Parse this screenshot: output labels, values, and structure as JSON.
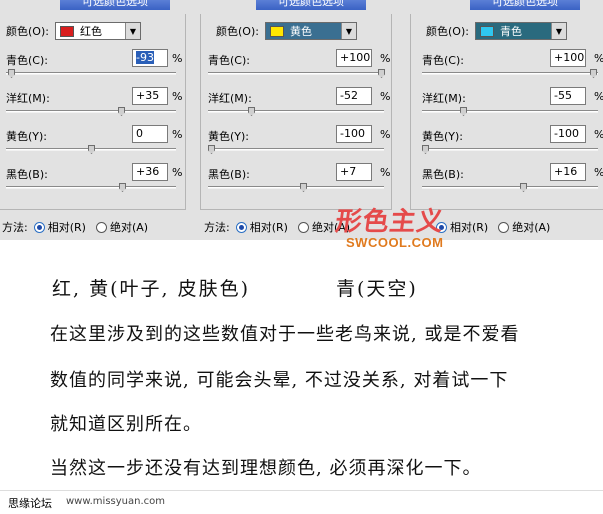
{
  "panels": [
    {
      "title": "可选颜色选项",
      "color_label": "颜色(O):",
      "color_value": "红色",
      "swatch": "#d81e1e",
      "fields": [
        {
          "label": "青色(C):",
          "value": "-93",
          "pct": "%",
          "slider": -93
        },
        {
          "label": "洋红(M):",
          "value": "+35",
          "pct": "%",
          "slider": 35
        },
        {
          "label": "黄色(Y):",
          "value": "0",
          "pct": "%",
          "slider": 0
        },
        {
          "label": "黑色(B):",
          "value": "+36",
          "pct": "%",
          "slider": 36
        }
      ],
      "method_label": "方法:",
      "relative_label": "相对(R)",
      "absolute_label": "绝对(A)"
    },
    {
      "title": "可选颜色选项",
      "color_label": "颜色(O):",
      "color_value": "黄色",
      "swatch": "#ffe600",
      "fields": [
        {
          "label": "青色(C):",
          "value": "+100",
          "pct": "%",
          "slider": 100
        },
        {
          "label": "洋红(M):",
          "value": "-52",
          "pct": "%",
          "slider": -52
        },
        {
          "label": "黄色(Y):",
          "value": "-100",
          "pct": "%",
          "slider": -100
        },
        {
          "label": "黑色(B):",
          "value": "+7",
          "pct": "%",
          "slider": 7
        }
      ],
      "method_label": "方法:",
      "relative_label": "相对(R)",
      "absolute_label": "绝对(A)"
    },
    {
      "title": "可选颜色选项",
      "color_label": "颜色(O):",
      "color_value": "青色",
      "swatch": "#2fc7ef",
      "fields": [
        {
          "label": "青色(C):",
          "value": "+100",
          "pct": "%",
          "slider": 100
        },
        {
          "label": "洋红(M):",
          "value": "-55",
          "pct": "%",
          "slider": -55
        },
        {
          "label": "黄色(Y):",
          "value": "-100",
          "pct": "%",
          "slider": -100
        },
        {
          "label": "黑色(B):",
          "value": "+16",
          "pct": "%",
          "slider": 16
        }
      ],
      "method_label": "方法:",
      "relative_label": "相对(R)",
      "absolute_label": "绝对(A)"
    }
  ],
  "logo": {
    "cn": "形色主义",
    "en": "SWCOOL.COM"
  },
  "handwriting": {
    "line1_left": "红, 黄(叶子, 皮肤色)",
    "line1_right": "青(天空)",
    "line2": "在这里涉及到的这些数值对于一些老鸟来说, 或是不爱看",
    "line3": "数值的同学来说, 可能会头晕, 不过没关系, 对着试一下",
    "line4": "就知道区别所在。",
    "line5": "当然这一步还没有达到理想颜色, 必须再深化一下。"
  },
  "footer": {
    "site": "思缘论坛",
    "url": "www.missyuan.com"
  },
  "colors": {
    "panel_bg": "#e2e2e2",
    "title_bar": "#3a62c4",
    "selection": "#2a5fb8"
  }
}
